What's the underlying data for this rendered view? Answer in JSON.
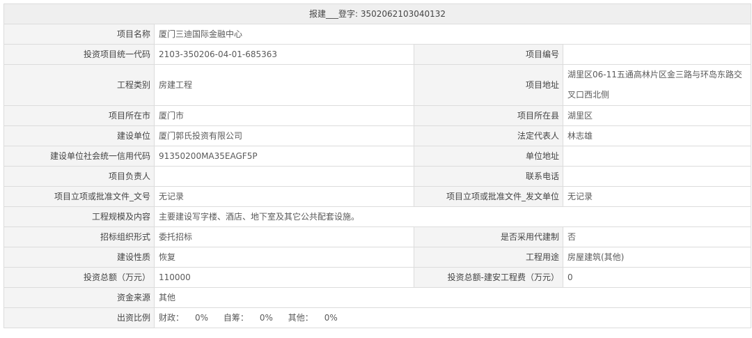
{
  "header": {
    "label": "报建___登字:",
    "value": "3502062103040132"
  },
  "fields": {
    "project_name": {
      "label": "项目名称",
      "value": "厦门三迪国际金融中心"
    },
    "unified_code": {
      "label": "投资项目统一代码",
      "value": "2103-350206-04-01-685363"
    },
    "project_number": {
      "label": "项目编号",
      "value": ""
    },
    "project_type": {
      "label": "工程类别",
      "value": "房建工程"
    },
    "project_address": {
      "label": "项目地址",
      "value": "湖里区06-11五通高林片区金三路与环岛东路交叉口西北侧"
    },
    "city": {
      "label": "项目所在市",
      "value": "厦门市"
    },
    "county": {
      "label": "项目所在县",
      "value": "湖里区"
    },
    "builder": {
      "label": "建设单位",
      "value": "厦门郭氏投资有限公司"
    },
    "legal_rep": {
      "label": "法定代表人",
      "value": "林志雄"
    },
    "credit_code": {
      "label": "建设单位社会统一信用代码",
      "value": "91350200MA35EAGF5P"
    },
    "unit_address": {
      "label": "单位地址",
      "value": ""
    },
    "project_lead": {
      "label": "项目负责人",
      "value": ""
    },
    "phone": {
      "label": "联系电话",
      "value": ""
    },
    "approval_doc_no": {
      "label": "项目立项或批准文件_文号",
      "value": "无记录"
    },
    "approval_doc_unit": {
      "label": "项目立项或批准文件_发文单位",
      "value": "无记录"
    },
    "scale_content": {
      "label": "工程规模及内容",
      "value": "主要建设写字楼、酒店、地下室及其它公共配套设施。"
    },
    "bidding_form": {
      "label": "招标组织形式",
      "value": "委托招标"
    },
    "agent_build": {
      "label": "是否采用代建制",
      "value": "否"
    },
    "build_nature": {
      "label": "建设性质",
      "value": "恢复"
    },
    "project_use": {
      "label": "工程用途",
      "value": "房屋建筑(其他)"
    },
    "total_invest": {
      "label": "投资总额（万元）",
      "value": "110000"
    },
    "install_cost": {
      "label": "投资总额-建安工程费（万元）",
      "value": "0"
    },
    "fund_source": {
      "label": "资金来源",
      "value": "其他"
    },
    "invest_ratio": {
      "label": "出资比例",
      "items": [
        {
          "name": "财政：",
          "value": "0%"
        },
        {
          "name": "自筹：",
          "value": "0%"
        },
        {
          "name": "其他：",
          "value": "0%"
        }
      ]
    }
  }
}
